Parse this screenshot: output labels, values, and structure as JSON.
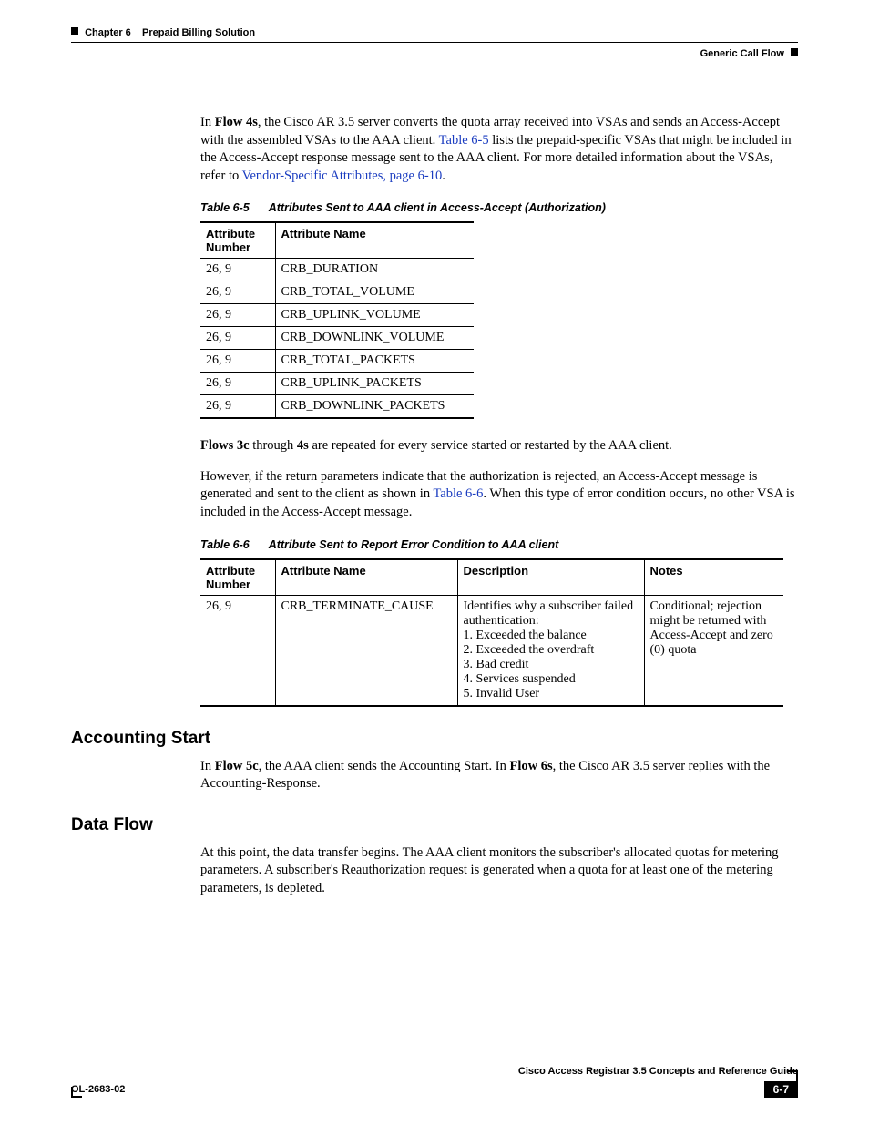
{
  "header": {
    "chapter": "Chapter 6",
    "chapterTitle": "Prepaid Billing Solution",
    "rightTitle": "Generic Call Flow"
  },
  "intro": {
    "p1_prefix": "In ",
    "p1_flow": "Flow 4s",
    "p1_mid1": ", the Cisco AR 3.5 server converts the quota array received into VSAs and sends an Access-Accept with the assembled VSAs to the AAA client. ",
    "p1_link1": "Table 6-5",
    "p1_mid2": " lists the prepaid-specific VSAs that might be included in the Access-Accept response message sent to the AAA client. For more detailed information about the VSAs, refer to ",
    "p1_link2": "Vendor-Specific Attributes, page 6-10",
    "p1_end": "."
  },
  "table65": {
    "captionNo": "Table 6-5",
    "captionText": "Attributes Sent to AAA client in Access-Accept (Authorization)",
    "h1": "Attribute Number",
    "h2": "Attribute Name",
    "rows": [
      {
        "num": "26, 9",
        "name": "CRB_DURATION"
      },
      {
        "num": "26, 9",
        "name": "CRB_TOTAL_VOLUME"
      },
      {
        "num": "26, 9",
        "name": "CRB_UPLINK_VOLUME"
      },
      {
        "num": "26, 9",
        "name": "CRB_DOWNLINK_VOLUME"
      },
      {
        "num": "26, 9",
        "name": "CRB_TOTAL_PACKETS"
      },
      {
        "num": "26, 9",
        "name": "CRB_UPLINK_PACKETS"
      },
      {
        "num": "26, 9",
        "name": "CRB_DOWNLINK_PACKETS"
      }
    ]
  },
  "mid": {
    "p2_b1": "Flows 3c",
    "p2_mid": " through ",
    "p2_b2": "4s",
    "p2_end": " are repeated for every service started or restarted by the AAA client.",
    "p3_start": "However, if the return parameters indicate that the authorization is rejected, an Access-Accept message is generated and sent to the client as shown in ",
    "p3_link": "Table 6-6",
    "p3_end": ". When this type of error condition occurs, no other VSA is included in the Access-Accept message."
  },
  "table66": {
    "captionNo": "Table 6-6",
    "captionText": "Attribute Sent to Report Error Condition to AAA client",
    "h1": "Attribute Number",
    "h2": "Attribute Name",
    "h3": "Description",
    "h4": "Notes",
    "row": {
      "num": "26, 9",
      "name": "CRB_TERMINATE_CAUSE",
      "desc_l1": "Identifies why a subscriber failed authentication:",
      "desc_l2": "1. Exceeded the balance",
      "desc_l3": "2. Exceeded the overdraft",
      "desc_l4": "3. Bad credit",
      "desc_l5": "4. Services suspended",
      "desc_l6": "5. Invalid User",
      "notes": "Conditional; rejection might be returned with Access-Accept and zero (0) quota"
    }
  },
  "sections": {
    "acct_title": "Accounting Start",
    "acct_p_pre": "In ",
    "acct_b1": "Flow 5c",
    "acct_mid1": ", the AAA client sends the Accounting Start. In ",
    "acct_b2": "Flow 6s",
    "acct_mid2": ", the Cisco AR 3.5 server replies with the Accounting-Response.",
    "data_title": "Data Flow",
    "data_p": "At this point, the data transfer begins. The AAA client monitors the subscriber's allocated quotas for metering parameters. A subscriber's Reauthorization request is generated when a quota for at least one of the metering parameters, is depleted."
  },
  "footer": {
    "guide": "Cisco Access Registrar 3.5 Concepts and Reference Guide",
    "docid": "OL-2683-02",
    "pageno": "6-7"
  }
}
